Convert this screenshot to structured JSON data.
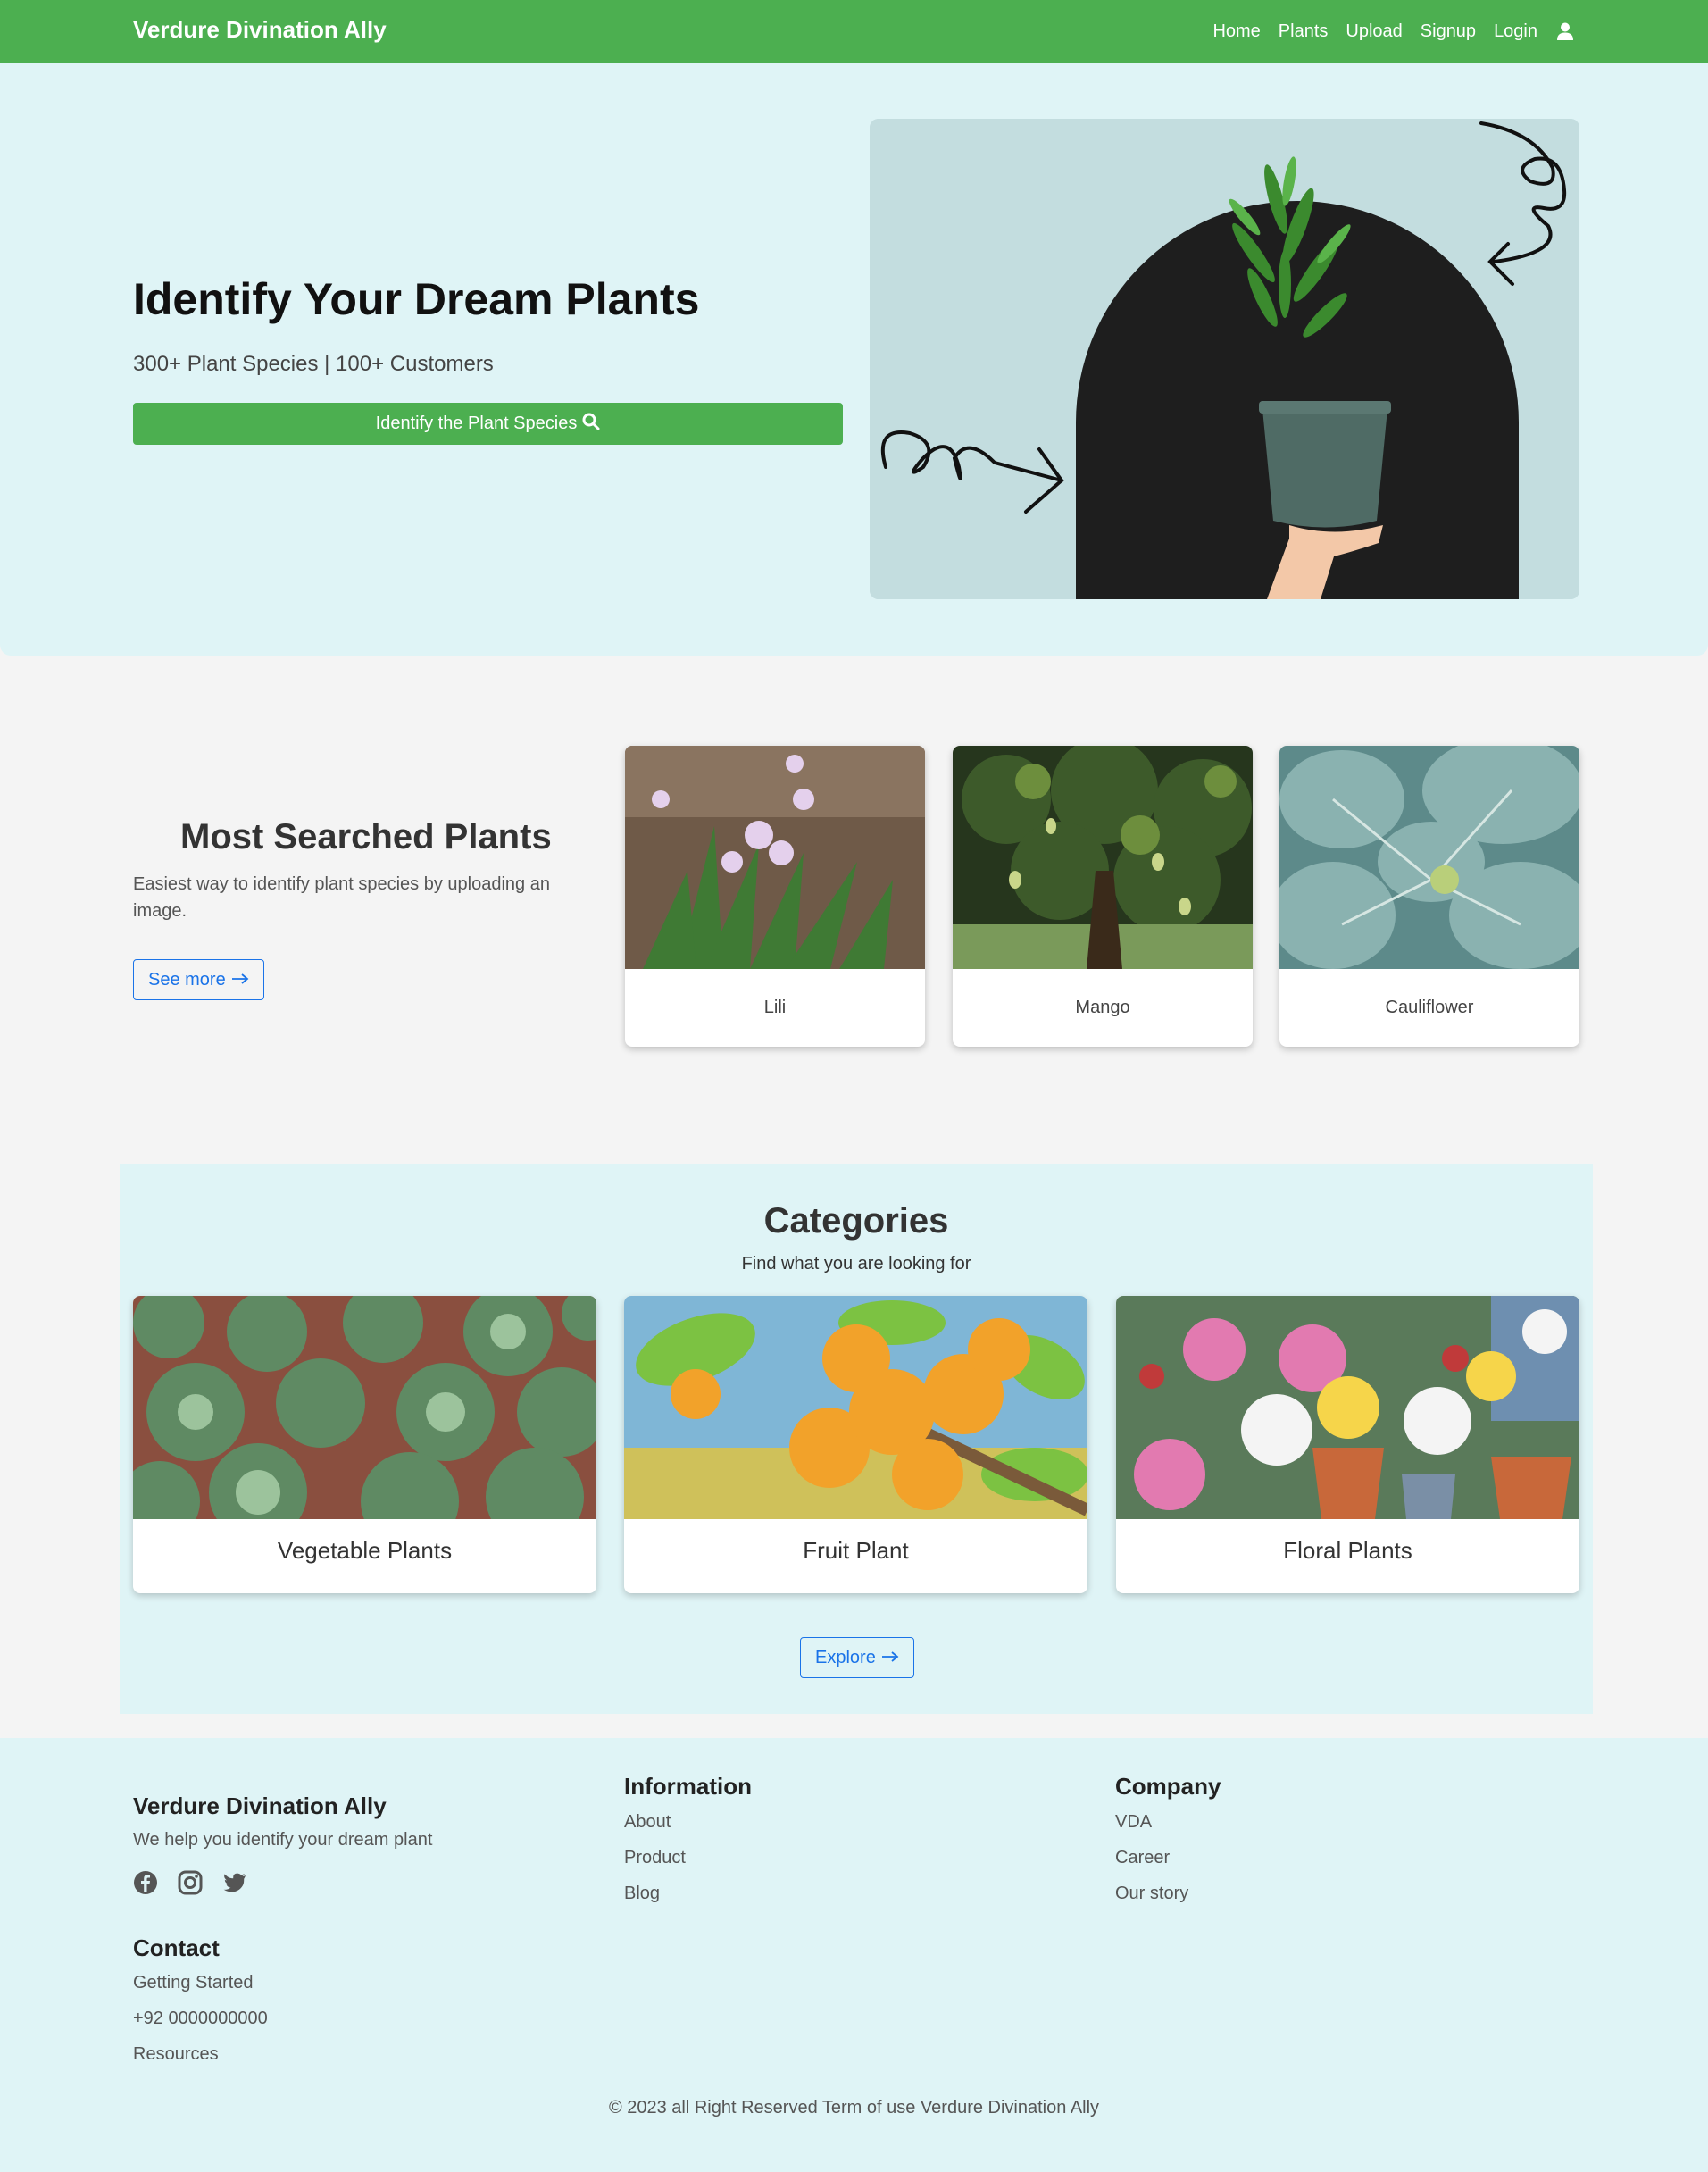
{
  "navbar": {
    "brand": "Verdure Divination Ally",
    "links": [
      "Home",
      "Plants",
      "Upload",
      "Signup",
      "Login"
    ],
    "user_icon": "user-icon"
  },
  "hero": {
    "title": "Identify Your Dream Plants",
    "subtitle": "300+ Plant Species | 100+ Customers",
    "button_label": "Identify the Plant Species",
    "button_icon": "search-icon"
  },
  "most_searched": {
    "title": "Most Searched Plants",
    "description": "Easiest way to identify plant species by uploading an image.",
    "see_more": "See more",
    "plants": [
      "Lili",
      "Mango",
      "Cauliflower"
    ]
  },
  "categories": {
    "title": "Categories",
    "subtitle": "Find what you are looking for",
    "items": [
      "Vegetable Plants",
      "Fruit Plant",
      "Floral Plants"
    ],
    "explore": "Explore"
  },
  "footer": {
    "brand": "Verdure Divination Ally",
    "tagline": "We help you identify your dream plant",
    "social_icons": [
      "facebook-icon",
      "instagram-icon",
      "twitter-icon"
    ],
    "contact_heading": "Contact",
    "contact_items": [
      "Getting Started",
      "+92 0000000000",
      "Resources"
    ],
    "information_heading": "Information",
    "information_items": [
      "About",
      "Product",
      "Blog"
    ],
    "company_heading": "Company",
    "company_items": [
      "VDA",
      "Career",
      "Our story"
    ],
    "copyright": "© 2023 all Right Reserved Term of use Verdure Divination Ally"
  },
  "colors": {
    "primary_green": "#4caf50",
    "light_teal_bg": "#dff4f6",
    "link_blue": "#1a73e8"
  }
}
